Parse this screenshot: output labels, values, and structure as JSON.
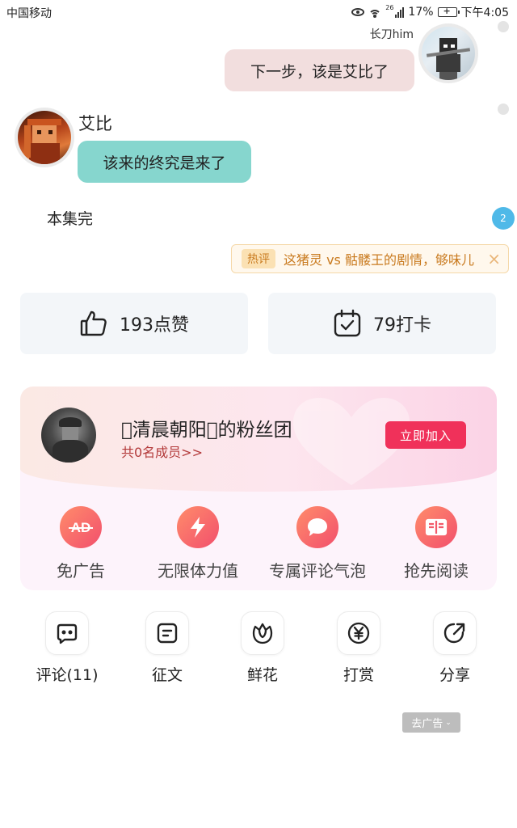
{
  "status_bar": {
    "carrier": "中国移动",
    "network": "26",
    "battery": "17%",
    "time": "下午4:05"
  },
  "chat": {
    "right_name": "长刀him",
    "right_message": "下一步，该是艾比了",
    "left_name": "艾比",
    "left_message": "该来的终究是来了"
  },
  "episode_end": "本集完",
  "comment_badge_count": "2",
  "hot_comment": {
    "tag": "热评",
    "text": "这猪灵 vs 骷髅王的剧情，够味儿",
    "close_icon": "×"
  },
  "stats": {
    "likes": "193点赞",
    "checkins": "79打卡"
  },
  "fan_club": {
    "title": "\u0000清晨朝阳\u0000的粉丝团",
    "members": "共0名成员>>",
    "join_label": "立即加入",
    "perks": [
      {
        "label": "免广告",
        "icon": "ad-free-icon"
      },
      {
        "label": "无限体力值",
        "icon": "lightning-icon"
      },
      {
        "label": "专属评论气泡",
        "icon": "chat-bubble-icon"
      },
      {
        "label": "抢先阅读",
        "icon": "book-icon"
      }
    ]
  },
  "actions": [
    {
      "label": "评论(11)",
      "icon": "comment-icon"
    },
    {
      "label": "征文",
      "icon": "essay-icon"
    },
    {
      "label": "鲜花",
      "icon": "flower-icon"
    },
    {
      "label": "打赏",
      "icon": "yen-coin-icon"
    },
    {
      "label": "分享",
      "icon": "share-icon"
    }
  ],
  "ad_button": "去广告",
  "colors": {
    "right_bubble": "#f2dede",
    "left_bubble": "#86d6ce",
    "join_button": "#f0315a",
    "perk_gradient_start": "#ff8c6b",
    "perk_gradient_end": "#f24f6c",
    "hot_text": "#c97a1e",
    "badge": "#4fb9e8"
  }
}
